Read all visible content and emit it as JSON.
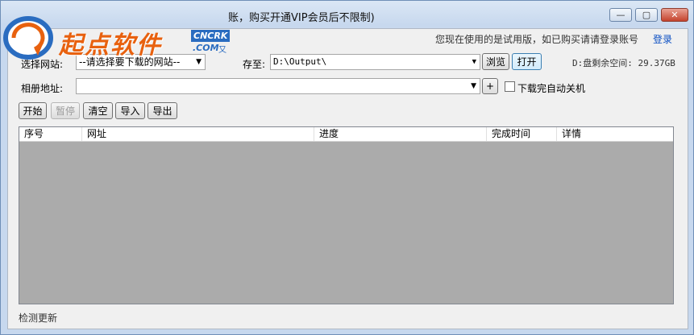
{
  "window": {
    "title": "账，购买开通VIP会员后不限制)",
    "controls": {
      "minimize": "▭",
      "maximize": "▢",
      "close": "✕"
    }
  },
  "watermark": {
    "text": "起点软件",
    "badge_top": "CNCRK",
    "badge_bottom": ".COM",
    "badge_suffix": "又"
  },
  "account": {
    "trial_notice": "您现在使用的是试用版，如已购买请请登录账号",
    "login_link": "登录"
  },
  "form": {
    "site_label": "选择网站:",
    "site_value": "--请选择要下载的网站--",
    "save_label": "存至:",
    "save_path": "D:\\Output\\",
    "browse_button": "浏览",
    "open_button": "打开",
    "disk_free": "D:盘剩余空间: 29.37GB",
    "album_label": "相册地址:",
    "album_value": "",
    "add_button": "+",
    "shutdown_label": "下载完自动关机"
  },
  "toolbar": {
    "start": "开始",
    "pause": "暂停",
    "clear": "清空",
    "import": "导入",
    "export": "导出"
  },
  "table": {
    "columns": [
      "序号",
      "网址",
      "进度",
      "完成时间",
      "详情"
    ]
  },
  "status": {
    "check_update": "检测更新"
  },
  "colors": {
    "accent_link": "#0a4ec2",
    "grid_bg": "#ababab",
    "logo_orange": "#e8610f",
    "logo_blue": "#2a6cc0"
  }
}
